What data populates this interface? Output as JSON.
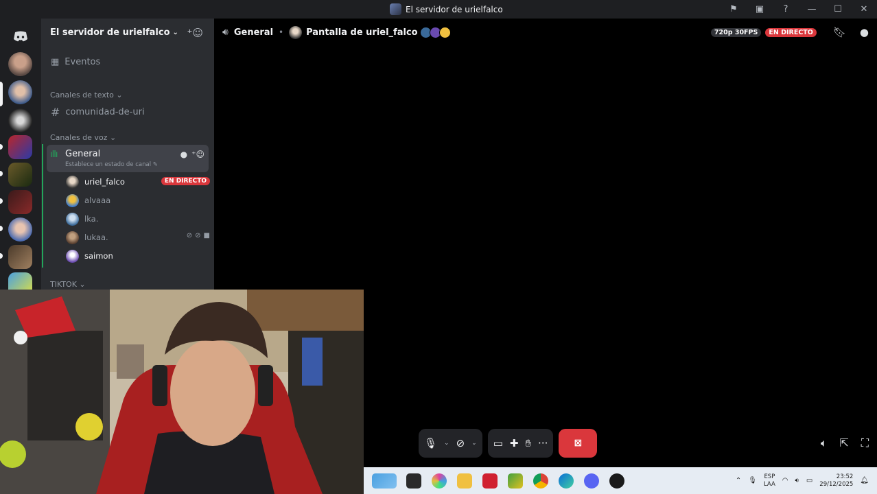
{
  "window": {
    "title": "El servidor de urielfalco",
    "controls": [
      "flag-icon",
      "screen-icon",
      "help-icon",
      "minimize",
      "maximize",
      "close"
    ]
  },
  "sidebar": {
    "server_name": "El servidor de urielfalco",
    "events_label": "Eventos",
    "text_category": "Canales de texto",
    "text_channel": "comunidad-de-uri",
    "voice_category": "Canales de voz",
    "voice_channel": {
      "name": "General",
      "status": "Establece un estado de canal"
    },
    "participants": [
      {
        "name": "uriel_falco",
        "badge": "EN DIRECTO",
        "color": "#f2f3f5"
      },
      {
        "name": "alvaaa",
        "color": "#949ba4"
      },
      {
        "name": "lka.",
        "color": "#949ba4"
      },
      {
        "name": "lukaa.",
        "color": "#949ba4"
      },
      {
        "name": "saimon",
        "color": "#f2f3f5"
      }
    ],
    "next_category": "TIKTOK"
  },
  "topbar": {
    "channel": "General",
    "stream": "Pantalla de uriel_falco",
    "quality": "720p 30FPS",
    "live": "EN DIRECTO"
  },
  "controls": {
    "icons": [
      "microphone-icon",
      "camera-off-icon",
      "screen-share-icon",
      "activities-icon",
      "soundboard-icon",
      "more-icon",
      "end-stream-icon"
    ]
  },
  "taskbar": {
    "lang_line1": "ESP",
    "lang_line2": "LAA",
    "time": "23:52",
    "date": "29/12/2025"
  },
  "colors": {
    "accent_live": "#da373c",
    "voice_green": "#23a55a",
    "sidebar_bg": "#2b2d31"
  }
}
